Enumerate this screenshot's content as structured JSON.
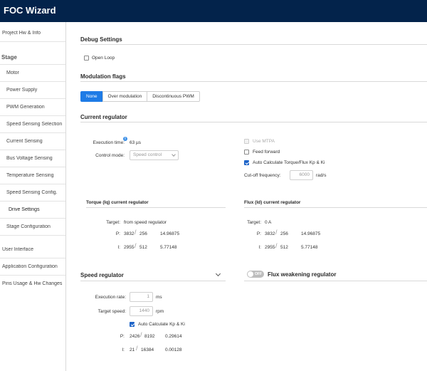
{
  "app": {
    "title": "FOC Wizard"
  },
  "sidebar": {
    "top_items": [
      {
        "label": "Project Hw & Info"
      }
    ],
    "group_label": "Stage",
    "stage_items": [
      {
        "label": "Motor"
      },
      {
        "label": "Power Supply"
      },
      {
        "label": "PWM Generation"
      },
      {
        "label": "Speed Sensing Selection"
      },
      {
        "label": "Current Sensing"
      },
      {
        "label": "Bus Voltage Sensing"
      },
      {
        "label": "Temperature Sensing"
      },
      {
        "label": "Speed Sensing Config."
      },
      {
        "label": "Drive Settings",
        "active": true
      },
      {
        "label": "Stage Configuration"
      }
    ],
    "bottom_items": [
      {
        "label": "User Interface"
      },
      {
        "label": "Application Configuration"
      },
      {
        "label": "Pins Usage & Hw Changes"
      }
    ]
  },
  "debug": {
    "title": "Debug Settings",
    "open_loop_label": "Open Loop",
    "open_loop_checked": false
  },
  "modulation": {
    "title": "Modulation flags",
    "options": [
      "None",
      "Over modulation",
      "Discontinuous PWM"
    ],
    "selected": "None"
  },
  "current_regulator": {
    "title": "Current regulator",
    "execution_time_label": "Execution time:",
    "execution_time_value": "63 µs",
    "info_icon_text": "i",
    "control_mode_label": "Control mode:",
    "control_mode_value": "Speed control",
    "use_mtpa_label": "Use MTPA",
    "use_mtpa_checked": false,
    "feed_forward_label": "Feed forward",
    "feed_forward_checked": false,
    "auto_calc_label": "Auto Calculate Torque/Flux Kp & Ki",
    "auto_calc_checked": true,
    "cutoff_label": "Cut-off frequency:",
    "cutoff_value": "6000",
    "cutoff_unit": "rad/s"
  },
  "torque_regulator": {
    "title": "Torque (Iq) current regulator",
    "target_label": "Target:",
    "target_value": "from speed regulator",
    "p_label": "P:",
    "p_num": "3832",
    "p_den": "256",
    "p_val": "14.96875",
    "i_label": "I:",
    "i_num": "2955",
    "i_den": "512",
    "i_val": "5.77148"
  },
  "flux_regulator": {
    "title": "Flux (Id) current regulator",
    "target_label": "Target:",
    "target_value": "0 A",
    "p_label": "P:",
    "p_num": "3832",
    "p_den": "256",
    "p_val": "14.96875",
    "i_label": "I:",
    "i_num": "2955",
    "i_den": "512",
    "i_val": "5.77148"
  },
  "speed_regulator": {
    "title": "Speed regulator",
    "exec_rate_label": "Execution rate:",
    "exec_rate_value": "1",
    "exec_rate_unit": "ms",
    "target_speed_label": "Target speed:",
    "target_speed_value": "1440",
    "target_speed_unit": "rpm",
    "auto_calc_label": "Auto Calculate Kp & Ki",
    "auto_calc_checked": true,
    "p_label": "P:",
    "p_num": "2426",
    "p_den": "8192",
    "p_val": "0.29614",
    "i_label": "I:",
    "i_num": "21",
    "i_den": "16384",
    "i_val": "0.00128"
  },
  "flux_weakening": {
    "title": "Flux weakening regulator",
    "toggle_label": "OFF",
    "enabled": false
  },
  "frac_separator": "/"
}
